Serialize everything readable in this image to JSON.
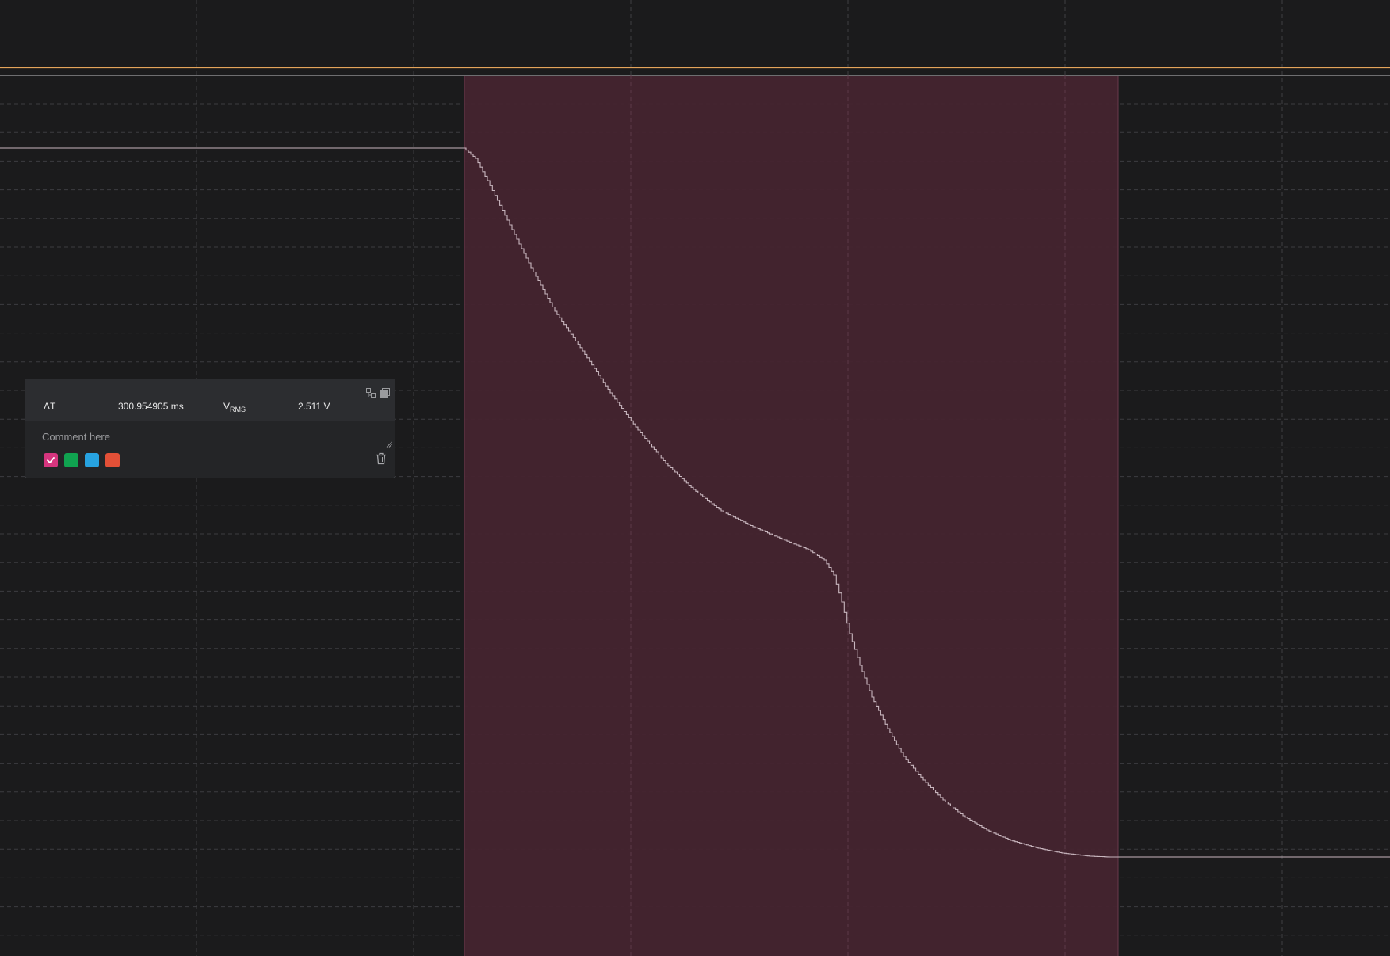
{
  "colors": {
    "background": "#1b1b1c",
    "selection_fill": "#45232f",
    "trace": "#c8b6be",
    "trigger_line": "#e4a45a"
  },
  "annotation": {
    "delta_t_label": "ΔT",
    "delta_t_value": "300.954905 ms",
    "vrms_label_main": "V",
    "vrms_label_sub": "RMS",
    "vrms_value": "2.511 V",
    "comment_placeholder": "Comment here",
    "expand_icon": "expand-icon",
    "copy_icon": "copy-icon",
    "trash_icon": "trash-icon",
    "swatches": [
      {
        "color": "#d6357e",
        "selected": true
      },
      {
        "color": "#10a350",
        "selected": false
      },
      {
        "color": "#27a3e1",
        "selected": false
      },
      {
        "color": "#e35037",
        "selected": false
      }
    ]
  }
}
